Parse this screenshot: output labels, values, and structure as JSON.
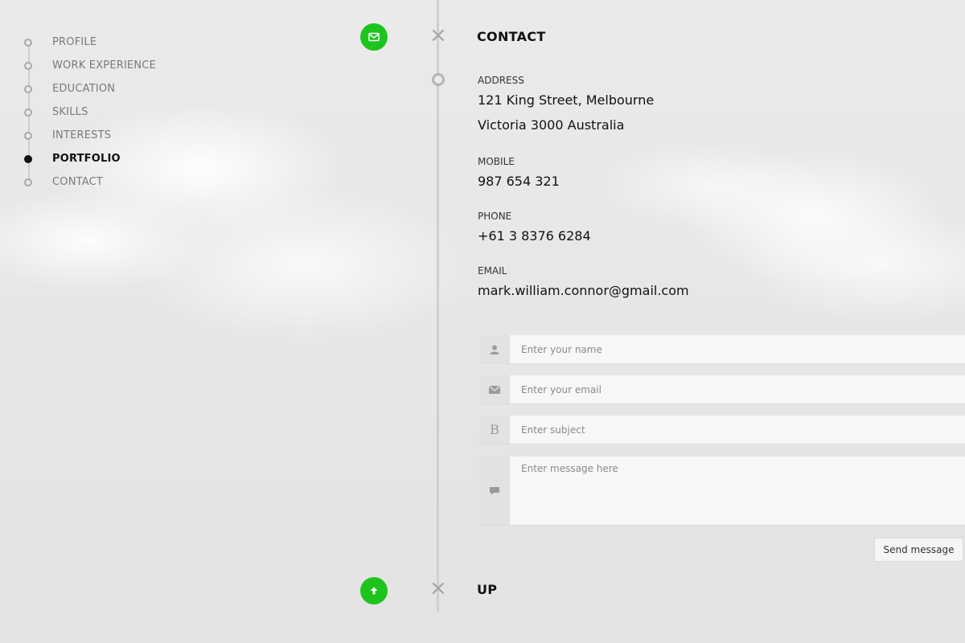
{
  "nav": {
    "items": [
      {
        "label": "PROFILE",
        "active": false
      },
      {
        "label": "WORK EXPERIENCE",
        "active": false
      },
      {
        "label": "EDUCATION",
        "active": false
      },
      {
        "label": "SKILLS",
        "active": false
      },
      {
        "label": "INTERESTS",
        "active": false
      },
      {
        "label": "PORTFOLIO",
        "active": true
      },
      {
        "label": "CONTACT",
        "active": false
      }
    ]
  },
  "timeline": {
    "top_button_icon": "envelope-icon",
    "bottom_button_icon": "arrow-up-icon",
    "accent_color": "#1ec41e"
  },
  "contact": {
    "title": "CONTACT",
    "address_label": "ADDRESS",
    "address_line1": "121 King Street, Melbourne",
    "address_line2": "Victoria 3000 Australia",
    "mobile_label": "MOBILE",
    "mobile": "987 654 321",
    "phone_label": "PHONE",
    "phone": "+61 3 8376 6284",
    "email_label": "EMAIL",
    "email": "mark.william.connor@gmail.com"
  },
  "form": {
    "name_placeholder": "Enter your name",
    "email_placeholder": "Enter your email",
    "subject_placeholder": "Enter subject",
    "message_placeholder": "Enter message here",
    "name_icon": "user-icon",
    "email_icon": "mail-icon",
    "subject_icon": "bold-icon",
    "message_icon": "comment-icon",
    "send_label": "Send message"
  },
  "up": {
    "title": "UP"
  }
}
